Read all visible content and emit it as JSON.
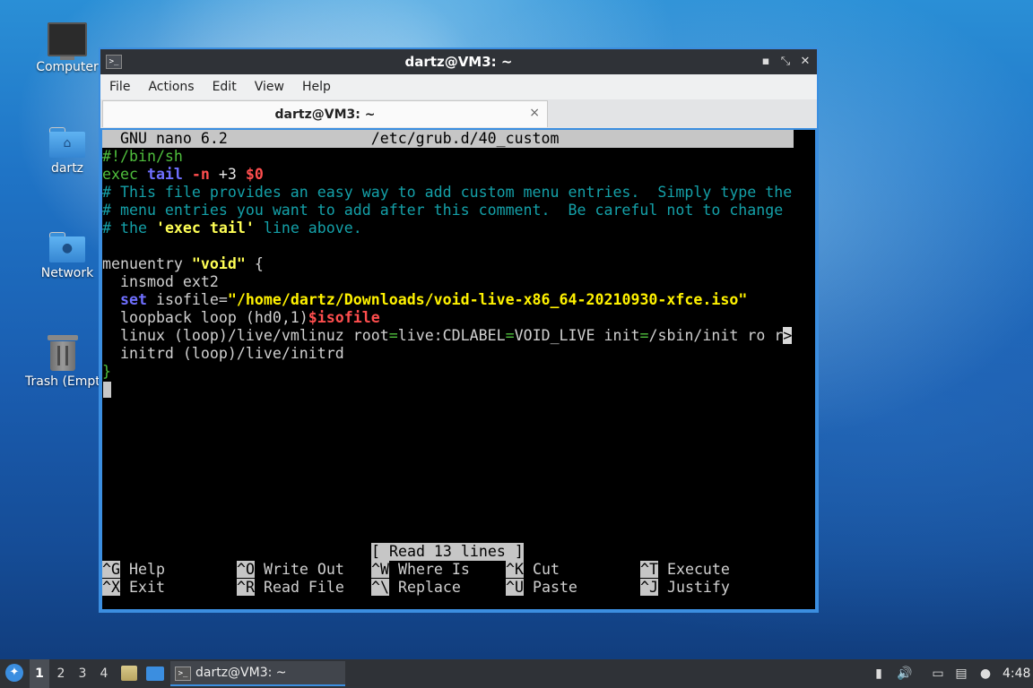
{
  "desktop": {
    "icons": [
      {
        "label": "Computer"
      },
      {
        "label": "dartz"
      },
      {
        "label": "Network"
      },
      {
        "label": "Trash (Empty)"
      }
    ]
  },
  "window": {
    "title": "dartz@VM3: ~",
    "menu": [
      "File",
      "Actions",
      "Edit",
      "View",
      "Help"
    ],
    "tab_title": "dartz@VM3: ~",
    "tab_close": "×",
    "btn_minimize": "▪",
    "btn_maximize": "⤡",
    "btn_close": "✕"
  },
  "nano": {
    "header_left": "GNU nano 6.2",
    "header_file": "/etc/grub.d/40_custom",
    "status": "[ Read 13 lines ]",
    "lines": {
      "l1": "#!/bin/sh",
      "l2_exec": "exec ",
      "l2_tail": "tail",
      "l2_sp": " ",
      "l2_n": "-n",
      "l2_num": " +3 ",
      "l2_var": "$0",
      "l3": "# This file provides an easy way to add custom menu entries.  Simply type the",
      "l4": "# menu entries you want to add after this comment.  Be careful not to change",
      "l5_a": "# the ",
      "l5_b": "'exec tail'",
      "l5_c": " line above.",
      "l7_a": "menuentry ",
      "l7_b": "\"void\"",
      "l7_c": " {",
      "l8": "  insmod ext2",
      "l9_a": "  ",
      "l9_set": "set",
      "l9_b": " isofile=",
      "l9_str": "\"/home/dartz/Downloads/void-live-x86_64-20210930-xfce.iso\"",
      "l10_a": "  loopback loop ",
      "l10_b": "(hd0,1)",
      "l10_var": "$isofile",
      "l11_a": "  linux ",
      "l11_b": "(loop)",
      "l11_c": "/live/vmlinuz root",
      "l11_d": "=",
      "l11_e": "live:CDLABEL",
      "l11_f": "=",
      "l11_g": "VOID_LIVE init",
      "l11_h": "=",
      "l11_i": "/sbin/init ro r",
      "l11_more": ">",
      "l12_a": "  initrd ",
      "l12_b": "(loop)",
      "l12_c": "/live/initrd",
      "l13": "}"
    },
    "shortcuts": [
      {
        "key": "^G",
        "label": " Help"
      },
      {
        "key": "^O",
        "label": " Write Out"
      },
      {
        "key": "^W",
        "label": " Where Is"
      },
      {
        "key": "^K",
        "label": " Cut"
      },
      {
        "key": "^T",
        "label": " Execute"
      },
      {
        "key": "^X",
        "label": " Exit"
      },
      {
        "key": "^R",
        "label": " Read File"
      },
      {
        "key": "^\\",
        "label": " Replace"
      },
      {
        "key": "^U",
        "label": " Paste"
      },
      {
        "key": "^J",
        "label": " Justify"
      }
    ]
  },
  "taskbar": {
    "workspaces": [
      "1",
      "2",
      "3",
      "4"
    ],
    "task_title": "dartz@VM3: ~",
    "clock": "4:48"
  }
}
